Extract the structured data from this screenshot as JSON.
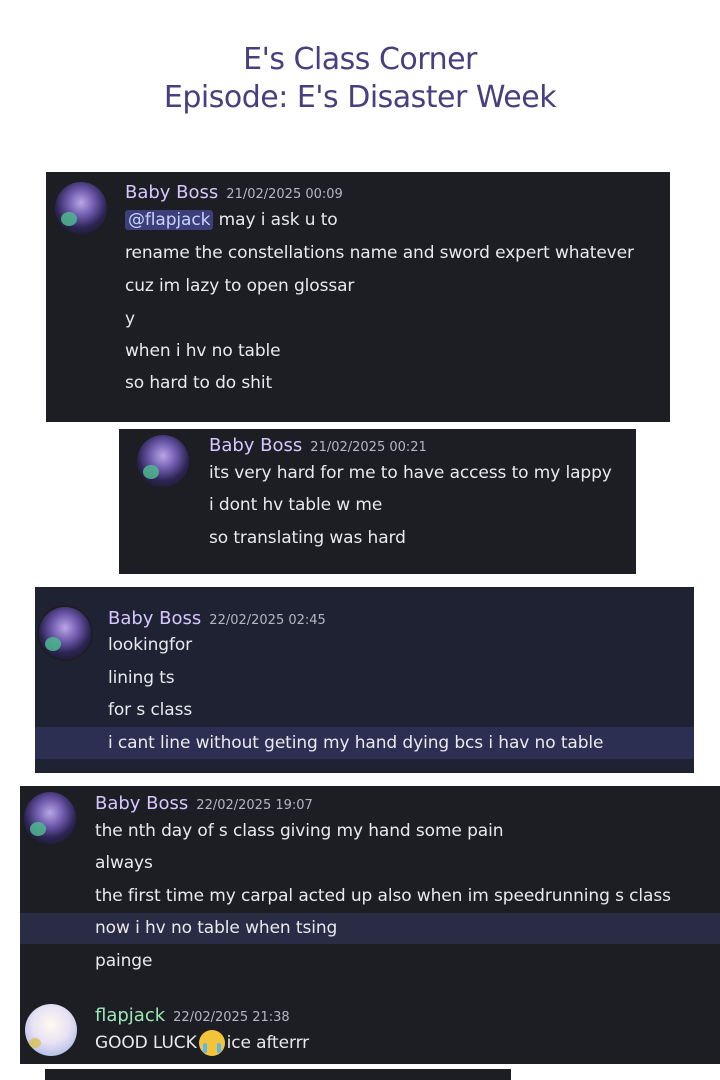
{
  "header": {
    "title_line1": "E's Class Corner",
    "title_line2": "Episode: E's Disaster Week"
  },
  "messages": [
    {
      "username": "Baby Boss",
      "timestamp": "21/02/2025 00:09",
      "mention": "@flapjack",
      "lines": [
        " may i ask  u to",
        "rename the constellations name and sword expert whatever",
        "cuz im lazy to open glossar",
        "y",
        "when i hv no table",
        "so hard to do shit"
      ]
    },
    {
      "username": "Baby Boss",
      "timestamp": "21/02/2025 00:21",
      "lines": [
        "its very hard for me to have access to my lappy",
        "i dont hv table w me",
        "so translating was hard"
      ]
    },
    {
      "username": "Baby Boss",
      "timestamp": "22/02/2025 02:45",
      "lines": [
        "lookingfor",
        "lining ts",
        "for s class",
        "i cant line without geting my hand dying bcs i hav no table"
      ]
    },
    {
      "username": "Baby Boss",
      "timestamp": "22/02/2025 19:07",
      "lines": [
        "the nth day of s class giving my hand some pain",
        "always",
        "the first time my carpal acted up also when im speedrunning s class",
        "now i hv no table when tsing",
        "painge"
      ]
    },
    {
      "username": "flapjack",
      "timestamp": "22/02/2025 21:38",
      "text_before_emoji": "GOOD LUCK",
      "emoji": "loudly-crying-face",
      "text_after_emoji": "ice afterrr"
    }
  ],
  "colors": {
    "title": "#4a3f7e",
    "panel_bg": "#1d1e24",
    "username_babyboss": "#d7c6ff",
    "username_flapjack": "#9ce8b6",
    "highlight_row": "#2d2f52"
  }
}
